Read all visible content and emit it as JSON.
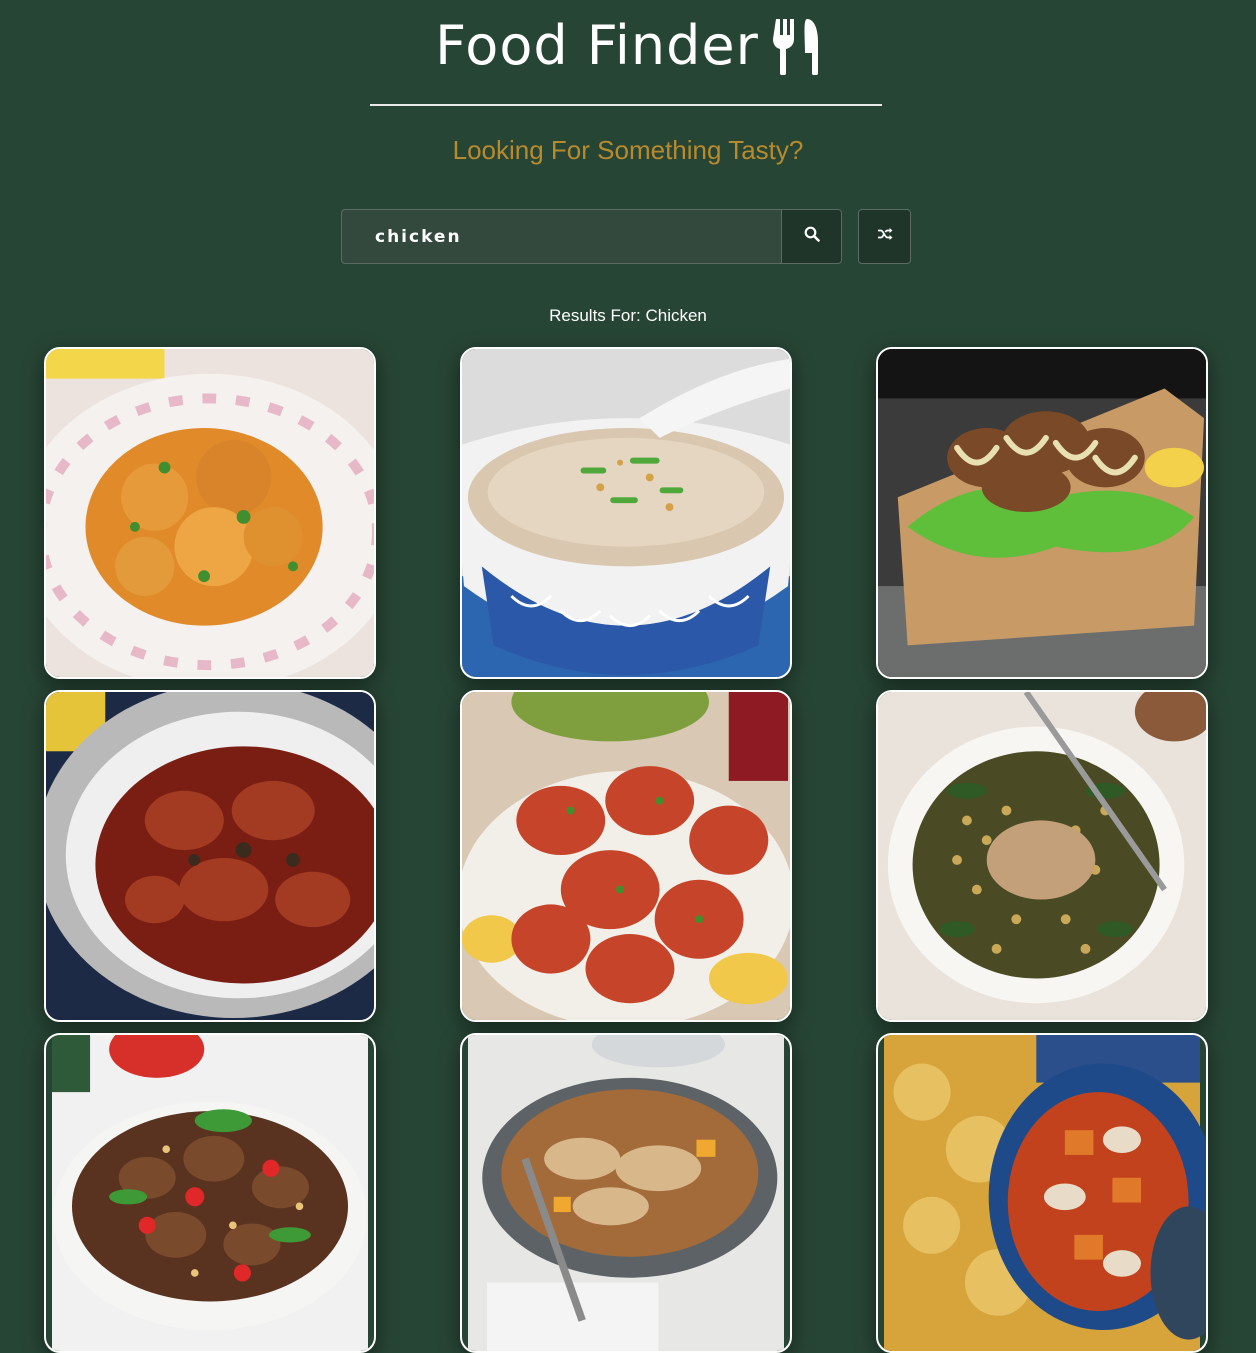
{
  "header": {
    "title": "Food Finder",
    "title_icon": "utensils-icon",
    "subtitle": "Looking For Something Tasty?"
  },
  "search": {
    "value": "chicken",
    "search_icon": "search-icon",
    "random_icon": "shuffle-icon"
  },
  "results": {
    "label": "Results For: Chicken",
    "cards": [
      {
        "icon": "curry-photo"
      },
      {
        "icon": "congee-photo"
      },
      {
        "icon": "fried-chicken-photo"
      },
      {
        "icon": "braised-chicken-photo"
      },
      {
        "icon": "tandoori-chicken-photo"
      },
      {
        "icon": "couscous-chicken-photo"
      },
      {
        "icon": "stir-fry-chicken-photo"
      },
      {
        "icon": "chicken-paella-photo"
      },
      {
        "icon": "chicken-pie-photo"
      }
    ]
  },
  "colors": {
    "background": "#274535",
    "accent": "#b88a2e",
    "button": "#20352a"
  }
}
